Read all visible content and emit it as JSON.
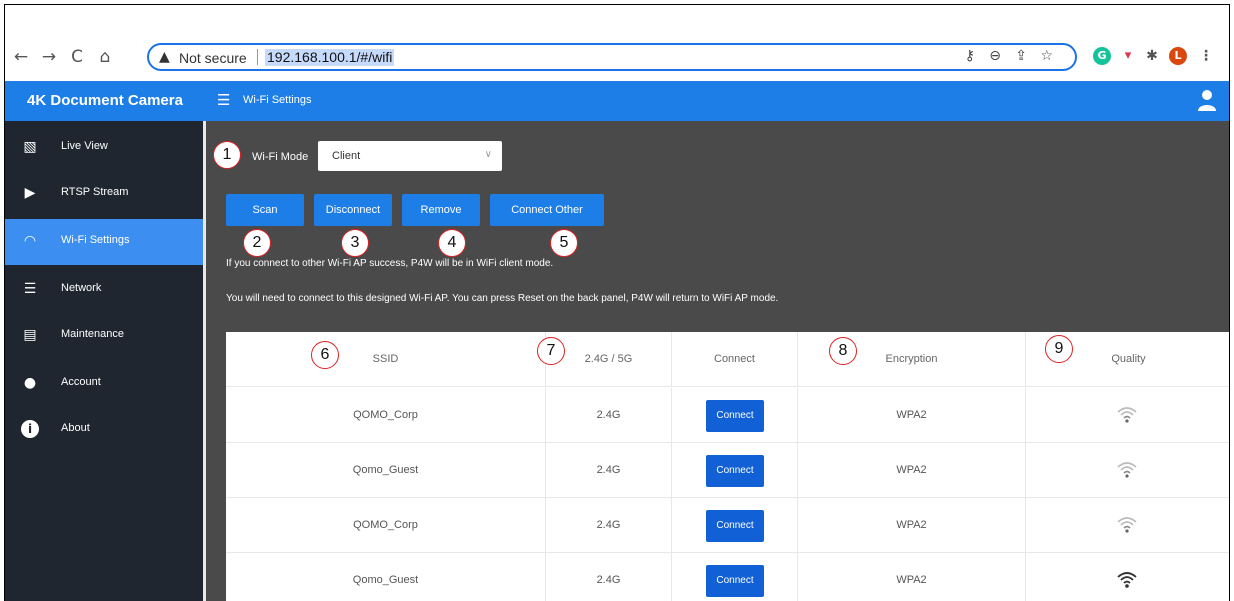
{
  "browser": {
    "back": "←",
    "forward": "→",
    "reload": "C",
    "home": "⌂",
    "security_icon": "▲",
    "security_text": "Not secure",
    "url": "192.168.100.1/#/wifi",
    "icons": [
      "key-icon",
      "zoom-icon",
      "share-icon",
      "star-icon",
      "grammarly-icon",
      "pocket-icon",
      "extensions-icon",
      "profile-icon",
      "more-icon"
    ],
    "profile_letter": "L"
  },
  "header": {
    "brand": "4K Document Camera",
    "menu_glyph": "☰",
    "page_title": "Wi-Fi Settings"
  },
  "sidebar": {
    "items": [
      {
        "label": "Live View",
        "icon": "image-icon",
        "glyph": "▧"
      },
      {
        "label": "RTSP Stream",
        "icon": "video-icon",
        "glyph": "▶"
      },
      {
        "label": "Wi-Fi Settings",
        "icon": "wifi-icon",
        "glyph": "◠"
      },
      {
        "label": "Network",
        "icon": "list-icon",
        "glyph": "☰"
      },
      {
        "label": "Maintenance",
        "icon": "maintenance-icon",
        "glyph": "▤"
      },
      {
        "label": "Account",
        "icon": "account-icon",
        "glyph": "●"
      },
      {
        "label": "About",
        "icon": "info-icon",
        "glyph": "i"
      }
    ],
    "active_index": 2
  },
  "main": {
    "mode_label": "Wi-Fi Mode",
    "mode_value": "Client",
    "buttons": {
      "scan": "Scan",
      "disconnect": "Disconnect",
      "remove": "Remove",
      "connect_other": "Connect Other"
    },
    "info_line_1": "If you connect to other Wi-Fi AP success, P4W will be in WiFi client mode.",
    "info_line_2": "You will need to connect to this designed Wi-Fi AP. You can press Reset on the back panel, P4W will return to WiFi AP mode."
  },
  "table": {
    "headers": {
      "ssid": "SSID",
      "band": "2.4G / 5G",
      "connect": "Connect",
      "encryption": "Encryption",
      "quality": "Quality"
    },
    "rows": [
      {
        "ssid": "QOMO_Corp",
        "band": "2.4G",
        "action": "Connect",
        "encryption": "WPA2",
        "quality_level": 0.25
      },
      {
        "ssid": "Qomo_Guest",
        "band": "2.4G",
        "action": "Connect",
        "encryption": "WPA2",
        "quality_level": 0.25
      },
      {
        "ssid": "QOMO_Corp",
        "band": "2.4G",
        "action": "Connect",
        "encryption": "WPA2",
        "quality_level": 0.25
      },
      {
        "ssid": "Qomo_Guest",
        "band": "2.4G",
        "action": "Connect",
        "encryption": "WPA2",
        "quality_level": 1.0
      }
    ]
  },
  "callouts": [
    "1",
    "2",
    "3",
    "4",
    "5",
    "6",
    "7",
    "8",
    "9"
  ],
  "colors": {
    "header_blue": "#1e7ee8",
    "sidebar_bg": "#1f2630",
    "sidebar_active": "#3c8ff0",
    "main_bg": "#4a4a4a",
    "connect_button": "#1160d6",
    "callout_border": "#dd2222"
  }
}
